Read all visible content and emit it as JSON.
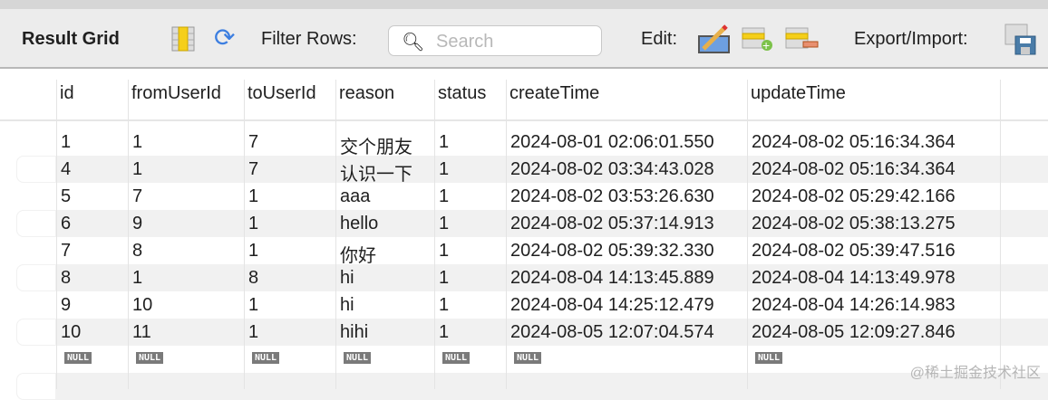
{
  "toolbar": {
    "title": "Result Grid",
    "filter_label": "Filter Rows:",
    "search_placeholder": "Search",
    "edit_label": "Edit:",
    "export_label": "Export/Import:",
    "icons": [
      "toggle-columns-icon",
      "refresh-icon",
      "edit-pencil-icon",
      "add-row-icon",
      "delete-row-icon",
      "export-save-icon"
    ]
  },
  "columns": [
    "id",
    "fromUserId",
    "toUserId",
    "reason",
    "status",
    "createTime",
    "updateTime"
  ],
  "rows": [
    [
      "1",
      "1",
      "7",
      "交个朋友",
      "1",
      "2024-08-01 02:06:01.550",
      "2024-08-02 05:16:34.364"
    ],
    [
      "4",
      "1",
      "7",
      "认识一下",
      "1",
      "2024-08-02 03:34:43.028",
      "2024-08-02 05:16:34.364"
    ],
    [
      "5",
      "7",
      "1",
      "aaa",
      "1",
      "2024-08-02 03:53:26.630",
      "2024-08-02 05:29:42.166"
    ],
    [
      "6",
      "9",
      "1",
      "hello",
      "1",
      "2024-08-02 05:37:14.913",
      "2024-08-02 05:38:13.275"
    ],
    [
      "7",
      "8",
      "1",
      "你好",
      "1",
      "2024-08-02 05:39:32.330",
      "2024-08-02 05:39:47.516"
    ],
    [
      "8",
      "1",
      "8",
      "hi",
      "1",
      "2024-08-04 14:13:45.889",
      "2024-08-04 14:13:49.978"
    ],
    [
      "9",
      "10",
      "1",
      "hi",
      "1",
      "2024-08-04 14:25:12.479",
      "2024-08-04 14:26:14.983"
    ],
    [
      "10",
      "11",
      "1",
      "hihi",
      "1",
      "2024-08-05 12:07:04.574",
      "2024-08-05 12:09:27.846"
    ]
  ],
  "null_label": "NULL",
  "watermark": "@稀土掘金技术社区"
}
